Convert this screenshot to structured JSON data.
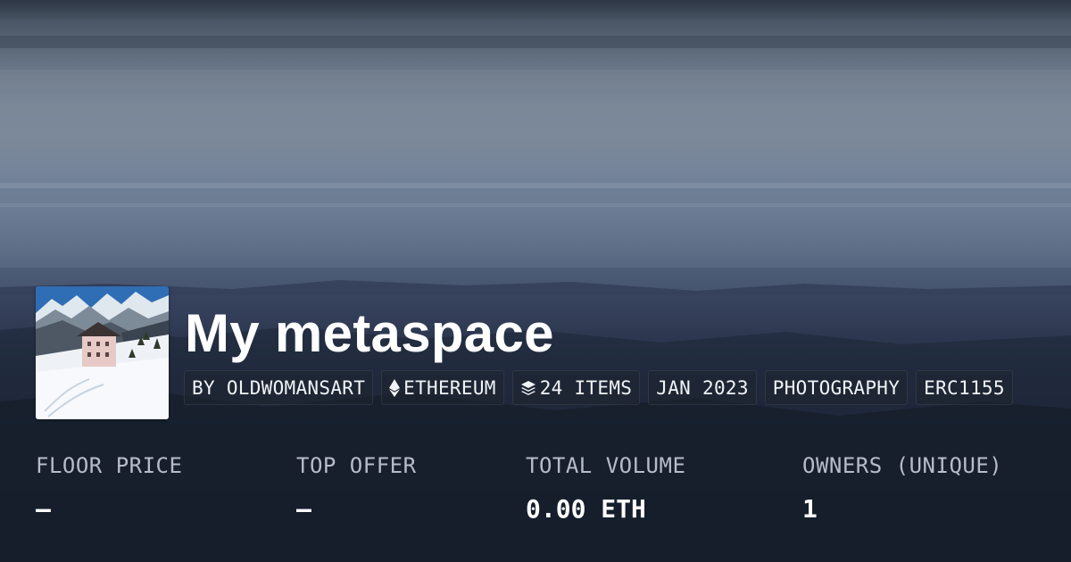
{
  "collection": {
    "title": "My metaspace",
    "tags": {
      "creator": "BY OLDWOMANSART",
      "chain": "ETHEREUM",
      "chain_icon": "ethereum-icon",
      "items": "24 ITEMS",
      "items_icon": "layers-icon",
      "date": "JAN 2023",
      "category": "PHOTOGRAPHY",
      "standard": "ERC1155"
    }
  },
  "stats": {
    "floor_price": {
      "label": "FLOOR PRICE",
      "value": "–"
    },
    "top_offer": {
      "label": "TOP OFFER",
      "value": "–"
    },
    "total_volume": {
      "label": "TOTAL VOLUME",
      "value": "0.00 ETH"
    },
    "owners": {
      "label": "OWNERS (UNIQUE)",
      "value": "1"
    }
  },
  "colors": {
    "text_primary": "#ffffff",
    "text_muted": "#b7bdc8",
    "tag_background": "#1e2430"
  }
}
